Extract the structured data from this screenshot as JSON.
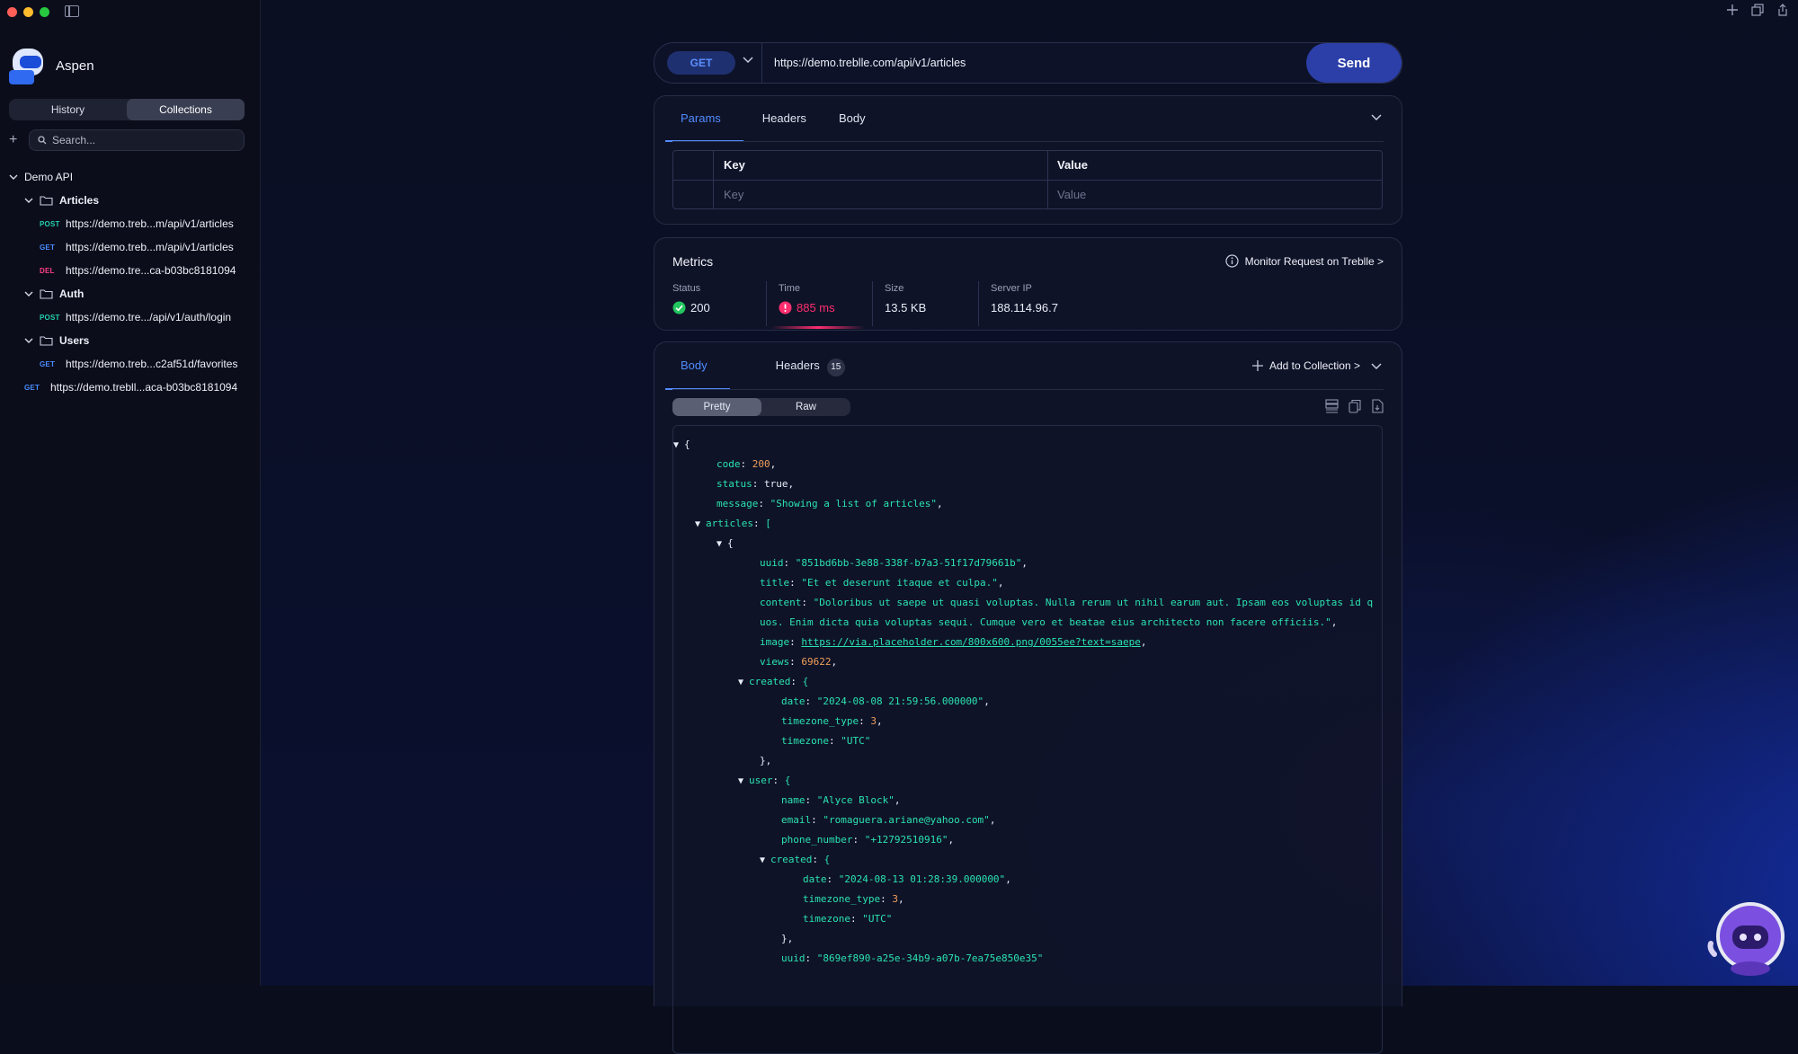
{
  "app": {
    "name": "Aspen"
  },
  "sidebar": {
    "segments": [
      "History",
      "Collections"
    ],
    "active_segment": "Collections",
    "search_placeholder": "Search...",
    "collection_name": "Demo API",
    "folders": [
      {
        "name": "Articles",
        "requests": [
          {
            "method": "POST",
            "url": "https://demo.treb...m/api/v1/articles"
          },
          {
            "method": "GET",
            "url": "https://demo.treb...m/api/v1/articles"
          },
          {
            "method": "DEL",
            "url": "https://demo.tre...ca-b03bc8181094"
          }
        ]
      },
      {
        "name": "Auth",
        "requests": [
          {
            "method": "POST",
            "url": "https://demo.tre.../api/v1/auth/login"
          }
        ]
      },
      {
        "name": "Users",
        "requests": [
          {
            "method": "GET",
            "url": "https://demo.treb...c2af51d/favorites"
          }
        ]
      }
    ],
    "loose_request": {
      "method": "GET",
      "url": "https://demo.trebll...aca-b03bc8181094"
    }
  },
  "request": {
    "method": "GET",
    "url": "https://demo.treblle.com/api/v1/articles",
    "send_label": "Send",
    "tabs": [
      "Params",
      "Headers",
      "Body"
    ],
    "active_tab": "Params",
    "params": {
      "key_header": "Key",
      "value_header": "Value",
      "key_placeholder": "Key",
      "value_placeholder": "Value"
    }
  },
  "metrics": {
    "title": "Metrics",
    "monitor_label": "Monitor Request on Treblle >",
    "status_label": "Status",
    "status_value": "200",
    "time_label": "Time",
    "time_value": "885 ms",
    "size_label": "Size",
    "size_value": "13.5 KB",
    "ip_label": "Server IP",
    "ip_value": "188.114.96.7",
    "colors": {
      "ok": "#22c55e",
      "slow": "#ff2e6e"
    }
  },
  "response": {
    "tabs": [
      "Body",
      "Headers"
    ],
    "headers_count": "15",
    "active_tab": "Body",
    "add_to_collection": "Add to Collection >",
    "view_modes": [
      "Pretty",
      "Raw"
    ],
    "active_view": "Pretty",
    "json_lines": [
      {
        "t": "{"
      },
      {
        "k": "code",
        "v": "200",
        "vt": "n"
      },
      {
        "k": "status",
        "v": "true",
        "vt": "b"
      },
      {
        "k": "message",
        "v": "\"Showing a list of articles\"",
        "vt": "s"
      },
      {
        "k": "articles",
        "v": "[",
        "vt": "p",
        "tog": true
      },
      {
        "t": "{",
        "tog": true
      },
      {
        "k": "uuid",
        "v": "\"851bd6bb-3e88-338f-b7a3-51f17d79661b\"",
        "vt": "s"
      },
      {
        "k": "title",
        "v": "\"Et et deserunt itaque et culpa.\"",
        "vt": "s"
      },
      {
        "k": "content",
        "v": "\"Doloribus ut saepe ut quasi voluptas. Nulla rerum ut nihil earum aut. Ipsam eos voluptas id q",
        "vt": "s",
        "nocomma": true
      },
      {
        "raw": "uos. Enim dicta quia voluptas sequi. Cumque vero et beatae eius architecto non facere officiis.\"",
        "vt": "s"
      },
      {
        "k": "image",
        "v": "https://via.placeholder.com/800x600.png/0055ee?text=saepe",
        "vt": "l"
      },
      {
        "k": "views",
        "v": "69622",
        "vt": "n"
      },
      {
        "k": "created",
        "v": "{",
        "vt": "p",
        "tog": true
      },
      {
        "k": "date",
        "v": "\"2024-08-08 21:59:56.000000\"",
        "vt": "s"
      },
      {
        "k": "timezone_type",
        "v": "3",
        "vt": "n"
      },
      {
        "k": "timezone",
        "v": "\"UTC\"",
        "vt": "s",
        "nocomma": true
      },
      {
        "t": "},"
      },
      {
        "k": "user",
        "v": "{",
        "vt": "p",
        "tog": true
      },
      {
        "k": "name",
        "v": "\"Alyce Block\"",
        "vt": "s"
      },
      {
        "k": "email",
        "v": "\"romaguera.ariane@yahoo.com\"",
        "vt": "s"
      },
      {
        "k": "phone_number",
        "v": "\"+12792510916\"",
        "vt": "s"
      },
      {
        "k": "created",
        "v": "{",
        "vt": "p",
        "tog": true
      },
      {
        "k": "date",
        "v": "\"2024-08-13 01:28:39.000000\"",
        "vt": "s"
      },
      {
        "k": "timezone_type",
        "v": "3",
        "vt": "n"
      },
      {
        "k": "timezone",
        "v": "\"UTC\"",
        "vt": "s",
        "nocomma": true
      },
      {
        "t": "},"
      },
      {
        "k": "uuid",
        "v": "\"869ef890-a25e-34b9-a07b-7ea75e850e35\"",
        "vt": "s",
        "nocomma": true
      }
    ]
  }
}
